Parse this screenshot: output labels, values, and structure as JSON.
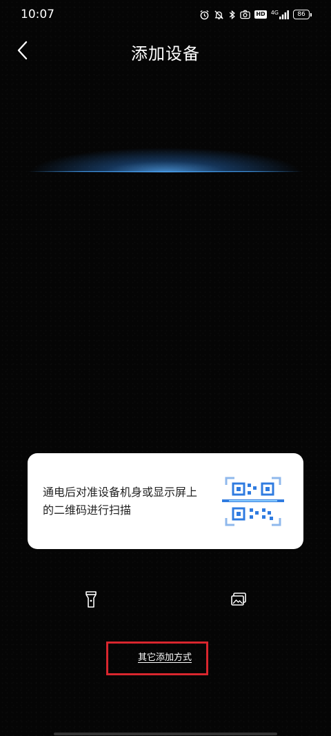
{
  "status_bar": {
    "time": "10:07",
    "hd_label": "HD",
    "network_label": "4G",
    "battery_level": "86"
  },
  "header": {
    "title": "添加设备",
    "back_icon": "chevron-left-icon"
  },
  "hint_card": {
    "text": "通电后对准设备机身或显示屏上的二维码进行扫描",
    "icon": "qr-code-scan-icon",
    "accent_color": "#2f7be0"
  },
  "tools": {
    "flashlight_icon": "flashlight-icon",
    "gallery_icon": "gallery-icon"
  },
  "other_methods": {
    "label": "其它添加方式",
    "highlight_color": "#d9262e"
  }
}
